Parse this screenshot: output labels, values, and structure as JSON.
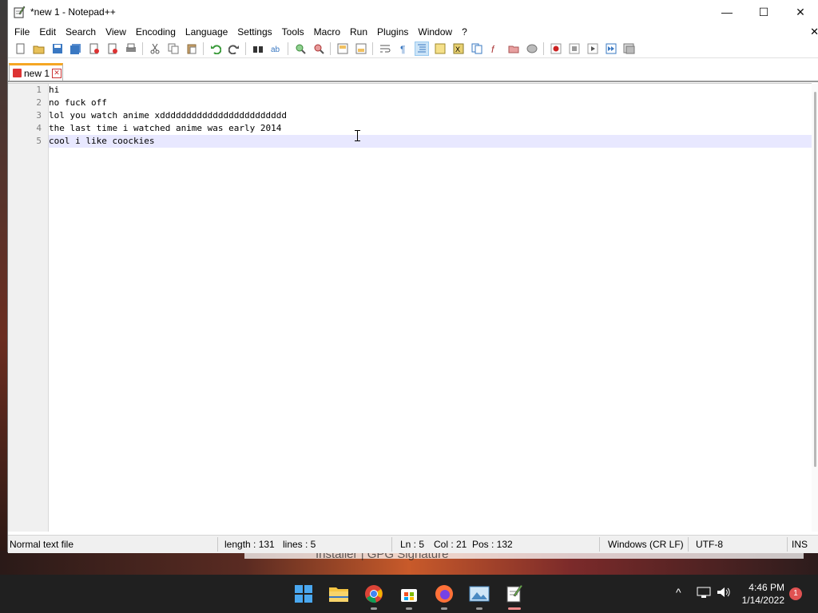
{
  "window": {
    "title": "*new 1 - Notepad++",
    "controls": {
      "minimize": "—",
      "maximize": "☐",
      "close": "✕"
    }
  },
  "menu": {
    "items": [
      "File",
      "Edit",
      "Search",
      "View",
      "Encoding",
      "Language",
      "Settings",
      "Tools",
      "Macro",
      "Run",
      "Plugins",
      "Window",
      "?"
    ],
    "close_glyph": "✕"
  },
  "tab": {
    "label": "new 1",
    "close_glyph": "✕"
  },
  "editor": {
    "lines": [
      {
        "number": "1",
        "text": "hi"
      },
      {
        "number": "2",
        "text": "no fuck off"
      },
      {
        "number": "3",
        "text": "lol you watch anime xdddddddddddddddddddddddd"
      },
      {
        "number": "4",
        "text": "the last time i watched anime was early 2014"
      },
      {
        "number": "5",
        "text": "cool i like coockies"
      }
    ],
    "current_line": 5
  },
  "status": {
    "file_type": "Normal text file",
    "length": "length : 131",
    "lines": "lines : 5",
    "ln": "Ln : 5",
    "col": "Col : 21",
    "pos": "Pos : 132",
    "eol": "Windows (CR LF)",
    "encoding": "UTF-8",
    "mode": "INS"
  },
  "behind_window": {
    "text": "Installer | GPG Signature"
  },
  "taskbar": {
    "apps": [
      "start-icon",
      "file-explorer-icon",
      "chrome-icon",
      "store-icon",
      "firefox-icon",
      "photos-icon",
      "notepadpp-icon"
    ],
    "time": "4:46 PM",
    "date": "1/14/2022",
    "notifications": "1"
  },
  "colors": {
    "tab_accent": "#f5a623",
    "current_line": "#e8e8ff",
    "taskbar": "#202020"
  }
}
